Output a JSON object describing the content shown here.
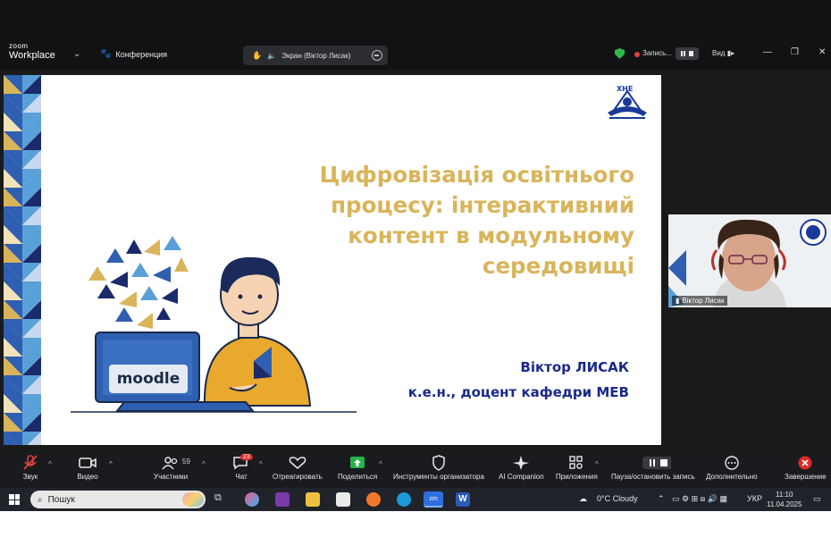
{
  "zoom": {
    "logo_small": "zoom",
    "logo_big": "Workplace",
    "conference_label": "Конференция",
    "screen_share_label": "Экран (Віктор Лисак)",
    "recording_label": "Запись...",
    "view_label": "Вид"
  },
  "slide": {
    "title_lines": [
      "Цифровізація освітнього",
      "процесу: інтерактивний",
      "контент в модульному",
      "середовищі"
    ],
    "author_name": "Віктор ЛИСАК",
    "author_role": "к.е.н., доцент кафедри МЕВ",
    "laptop_brand": "moodle"
  },
  "participant": {
    "name": "Віктор Лисак"
  },
  "toolbar": {
    "items": [
      {
        "label": "Звук"
      },
      {
        "label": "Видео"
      },
      {
        "label": "Участники",
        "count": "59"
      },
      {
        "label": "Чат",
        "badge": "23"
      },
      {
        "label": "Отреагировать"
      },
      {
        "label": "Поделиться"
      },
      {
        "label": "Инструменты организатора"
      },
      {
        "label": "AI Companion"
      },
      {
        "label": "Приложения"
      },
      {
        "label": "Пауза/остановить запись"
      },
      {
        "label": "Дополнительно"
      },
      {
        "label": "Завершение"
      }
    ]
  },
  "taskbar": {
    "search_placeholder": "Пошук",
    "weather": "0°C  Cloudy",
    "language": "УКР",
    "time": "11:10",
    "date": "11.04.2025"
  },
  "colors": {
    "slide_title": "#d9b45a",
    "slide_author": "#1a2a8a",
    "zoom_dark": "#1a1b1e",
    "accent_blue": "#1f6fd1"
  }
}
